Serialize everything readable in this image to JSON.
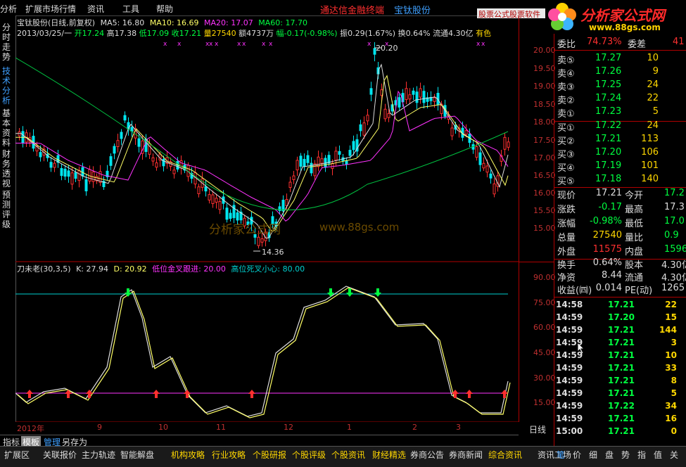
{
  "menu": {
    "items": [
      "分析",
      "扩展市场行情",
      "资讯",
      "工具",
      "帮助"
    ],
    "banner": "通达信金融终端",
    "stock_name": "宝钛股份",
    "software_tab": "股票公式股票软件",
    "logo_text": "分析家公式网",
    "logo_url": "www.88gs.com"
  },
  "left_tabs": [
    {
      "label": "分时走势",
      "active": false
    },
    {
      "label": "技术分析",
      "active": true
    },
    {
      "label": "基本资料",
      "active": false
    },
    {
      "label": "财务透视",
      "active": false
    },
    {
      "label": "预测评级",
      "active": false
    }
  ],
  "header": {
    "title": "宝钛股份(日线,前复权)",
    "ma5": "MA5: 16.80",
    "ma10": "MA10: 16.69",
    "ma20": "MA20: 17.07",
    "ma60": "MA60: 17.70",
    "date": "2013/03/25/一",
    "open": "开17.24",
    "high": "高17.38",
    "low": "低17.09",
    "close": "收17.21",
    "volume": "量27540",
    "amount": "额4737万",
    "change": "幅-0.17(-0.98%)",
    "amplitude": "振0.29(1.67%)",
    "turnover": "换0.64%",
    "float": "流通4.30亿",
    "color_label": "有色"
  },
  "annotations": {
    "high_marker": "20.20",
    "low_marker": "14.36",
    "watermark_cn": "分析家公式网",
    "watermark_url": "www.88gs.com"
  },
  "indicator": {
    "title": "刀未老(30,3,5)",
    "k": "K: 27.94",
    "d": "D: 20.92",
    "low_label": "低位金叉跟进: 20.00",
    "high_label": "高位死叉小心: 80.00"
  },
  "price_axis": [
    "20.00",
    "19.50",
    "19.00",
    "18.50",
    "18.00",
    "17.50",
    "17.00",
    "16.50",
    "16.00",
    "15.50",
    "15.00"
  ],
  "indicator_axis": [
    "90.00",
    "75.00",
    "60.00",
    "45.00",
    "30.00",
    "15.00"
  ],
  "time_axis": [
    "2012年",
    "9",
    "10",
    "11",
    "12",
    "1",
    "2",
    "3"
  ],
  "period_label": "日线",
  "quote": {
    "weibi_label": "委比",
    "weibi_value": "74.73%",
    "weicha_label": "委差",
    "weicha_value": "41",
    "sells": [
      {
        "label": "卖⑤",
        "price": "17.27",
        "vol": "10"
      },
      {
        "label": "卖④",
        "price": "17.26",
        "vol": "9"
      },
      {
        "label": "卖③",
        "price": "17.25",
        "vol": "24"
      },
      {
        "label": "卖②",
        "price": "17.24",
        "vol": "22"
      },
      {
        "label": "卖①",
        "price": "17.23",
        "vol": "5"
      }
    ],
    "buys": [
      {
        "label": "买①",
        "price": "17.22",
        "vol": "24"
      },
      {
        "label": "买②",
        "price": "17.21",
        "vol": "113"
      },
      {
        "label": "买③",
        "price": "17.20",
        "vol": "106"
      },
      {
        "label": "买④",
        "price": "17.19",
        "vol": "101"
      },
      {
        "label": "买⑤",
        "price": "17.18",
        "vol": "140"
      }
    ],
    "stats": [
      {
        "l1": "现价",
        "v1": "17.21",
        "c1": "#ddd",
        "l2": "今开",
        "v2": "17.2",
        "c2": "#00ff40"
      },
      {
        "l1": "涨跌",
        "v1": "-0.17",
        "c1": "#00ff40",
        "l2": "最高",
        "v2": "17.3",
        "c2": "#ddd"
      },
      {
        "l1": "涨幅",
        "v1": "-0.98%",
        "c1": "#00ff40",
        "l2": "最低",
        "v2": "17.0",
        "c2": "#00ff40"
      },
      {
        "l1": "总量",
        "v1": "27540",
        "c1": "#ffd700",
        "l2": "量比",
        "v2": "0.9",
        "c2": "#00ff40"
      },
      {
        "l1": "外盘",
        "v1": "11575",
        "c1": "#ff3030",
        "l2": "内盘",
        "v2": "1596",
        "c2": "#00ff40"
      }
    ],
    "stats2": [
      {
        "l1": "换手",
        "v1": "0.64%",
        "l2": "股本",
        "v2": "4.30亿"
      },
      {
        "l1": "净资",
        "v1": "8.44",
        "l2": "流通",
        "v2": "4.30亿"
      },
      {
        "l1": "收益(㈣)",
        "v1": "0.014",
        "l2": "PE(动)",
        "v2": "1265"
      }
    ],
    "ticks": [
      {
        "time": "14:58",
        "price": "17.21",
        "vol": "22"
      },
      {
        "time": "14:59",
        "price": "17.20",
        "vol": "15"
      },
      {
        "time": "14:59",
        "price": "17.21",
        "vol": "144"
      },
      {
        "time": "14:59",
        "price": "17.21",
        "vol": "3"
      },
      {
        "time": "14:59",
        "price": "17.21",
        "vol": "10"
      },
      {
        "time": "14:59",
        "price": "17.21",
        "vol": "33"
      },
      {
        "time": "14:59",
        "price": "17.21",
        "vol": "8"
      },
      {
        "time": "14:59",
        "price": "17.21",
        "vol": "5"
      },
      {
        "time": "14:59",
        "price": "17.22",
        "vol": "34"
      },
      {
        "time": "14:59",
        "price": "17.21",
        "vol": "16"
      },
      {
        "time": "15:00",
        "price": "17.21",
        "vol": "0"
      }
    ]
  },
  "sub_tabs": [
    "指标",
    "模板",
    "管理",
    "另存为"
  ],
  "bottom_items": [
    {
      "label": "扩展区",
      "color": "#ddd"
    },
    {
      "label": "关联报价",
      "color": "#ddd"
    },
    {
      "label": "主力轨迹",
      "color": "#ddd"
    },
    {
      "label": "智能解盘",
      "color": "#ddd"
    },
    {
      "label": "机构攻略",
      "color": "#ffd700"
    },
    {
      "label": "行业攻略",
      "color": "#ffd700"
    },
    {
      "label": "个股研报",
      "color": "#ffd700"
    },
    {
      "label": "个股评级",
      "color": "#ffd700"
    },
    {
      "label": "个股资讯",
      "color": "#ffd700"
    },
    {
      "label": "财经精选",
      "color": "#ffd700"
    },
    {
      "label": "券商公告",
      "color": "#ddd"
    },
    {
      "label": "券商新闻",
      "color": "#ddd"
    },
    {
      "label": "综合资讯",
      "color": "#ffd700"
    },
    {
      "label": "资讯工场",
      "color": "#ddd"
    }
  ],
  "right_buttons": [
    "笔",
    "价",
    "细",
    "盘",
    "势",
    "指",
    "值",
    "关"
  ]
}
